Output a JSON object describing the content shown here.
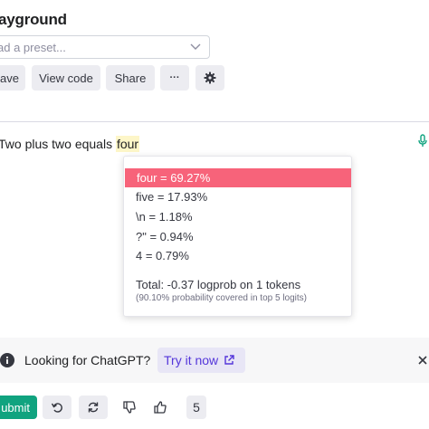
{
  "header": {
    "title": "ayground"
  },
  "preset": {
    "placeholder": "ad a preset..."
  },
  "toolbar": {
    "save_label": "ave",
    "view_code_label": "View code",
    "share_label": "Share",
    "more_label": "···",
    "settings_icon": "gear-icon"
  },
  "prompt": {
    "text_before": "Two plus two equals ",
    "completion": "four"
  },
  "logprobs": {
    "tokens": [
      {
        "label": "four = 69.27%"
      },
      {
        "label": "five = 17.93%"
      },
      {
        "label": "\\n = 1.18%"
      },
      {
        "label": "?\" = 0.94%"
      },
      {
        "label": "4 = 0.79%"
      }
    ],
    "total": "Total: -0.37 logprob on 1 tokens",
    "covered": "(90.10% probability covered in top 5 logits)"
  },
  "banner": {
    "text": "Looking for ChatGPT?",
    "cta": "Try it now"
  },
  "footer": {
    "submit_label": "ubmit",
    "count": "5"
  },
  "colors": {
    "accent_green": "#10a37f",
    "selected_token": "#f7637a",
    "highlight": "#fdf6c8",
    "cta_purple": "#5436da"
  }
}
